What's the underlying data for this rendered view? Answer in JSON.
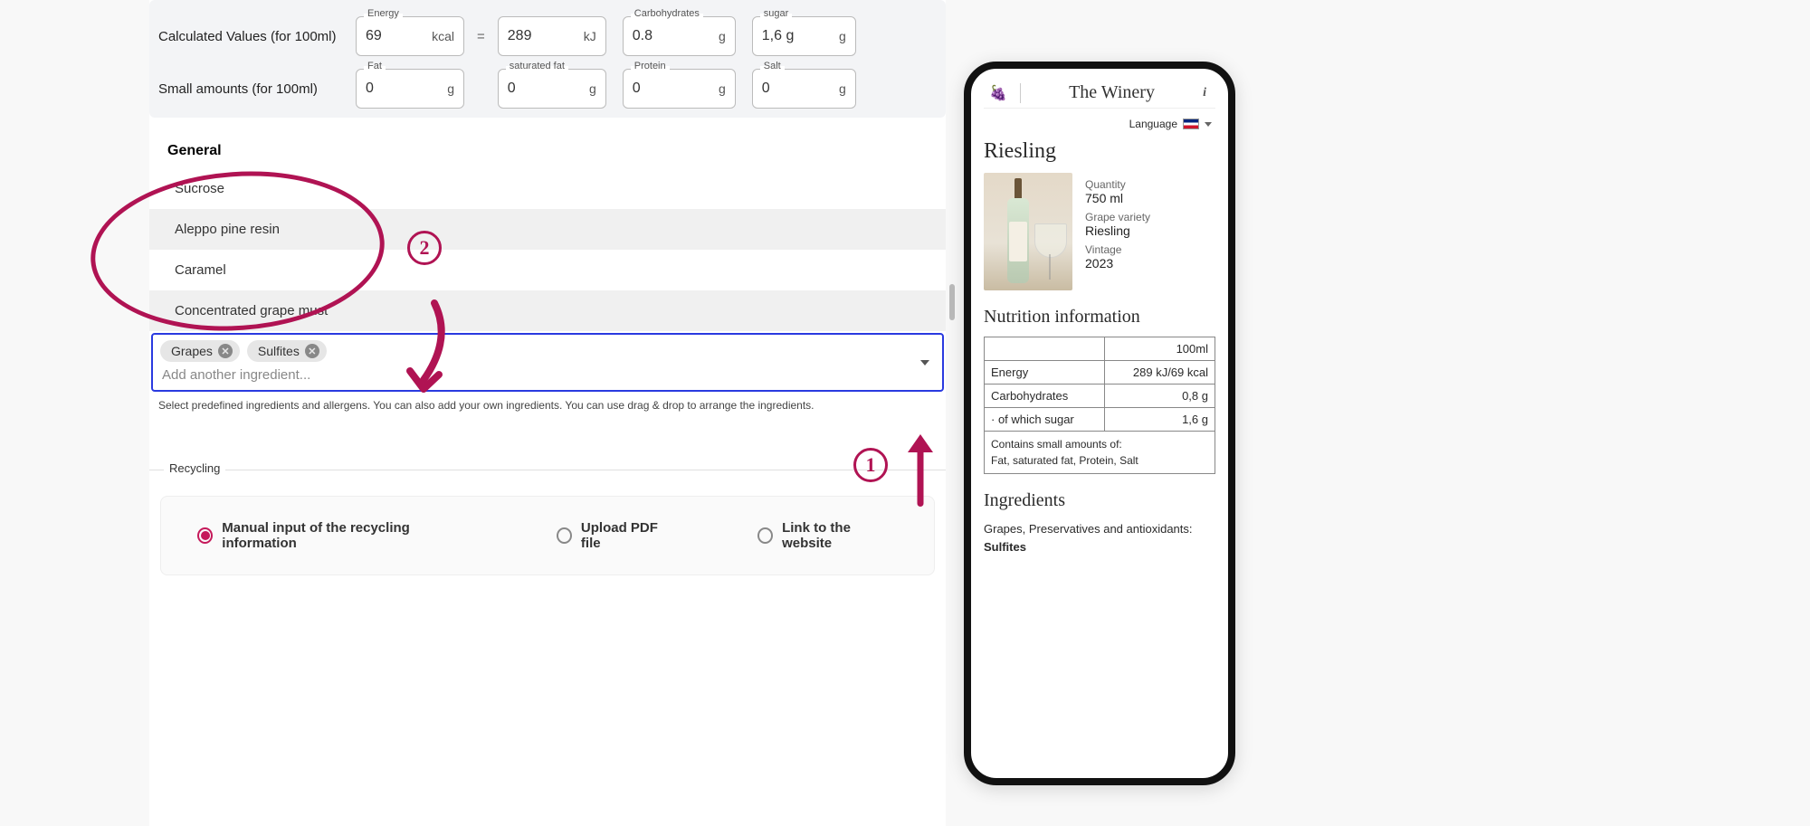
{
  "calc": {
    "label": "Calculated Values (for 100ml)",
    "energy_label": "Energy",
    "energy_kcal": "69",
    "energy_kcal_unit": "kcal",
    "eq": "=",
    "energy_kj": "289",
    "energy_kj_unit": "kJ",
    "carbs_label": "Carbohydrates",
    "carbs": "0.8",
    "carbs_unit": "g",
    "sugar_label": "sugar",
    "sugar": "1,6 g",
    "sugar_unit": "g"
  },
  "small": {
    "label": "Small amounts (for 100ml)",
    "fat_label": "Fat",
    "fat": "0",
    "fat_unit": "g",
    "satfat_label": "saturated fat",
    "satfat": "0",
    "satfat_unit": "g",
    "protein_label": "Protein",
    "protein": "0",
    "protein_unit": "g",
    "salt_label": "Salt",
    "salt": "0",
    "salt_unit": "g"
  },
  "dropdown": {
    "header": "General",
    "items": [
      "Sucrose",
      "Aleppo pine resin",
      "Caramel",
      "Concentrated grape must"
    ]
  },
  "ingredients": {
    "chips": [
      "Grapes",
      "Sulfites"
    ],
    "placeholder": "Add another ingredient...",
    "helper": "Select predefined ingredients and allergens. You can also add your own ingredients. You can use drag & drop to arrange the ingredients."
  },
  "recycling": {
    "legend": "Recycling",
    "opts": [
      "Manual input of the recycling information",
      "Upload PDF file",
      "Link to the website"
    ],
    "selected": 0
  },
  "annotations": {
    "badge1": "1",
    "badge2": "2"
  },
  "phone": {
    "brand": "The Winery",
    "language_label": "Language",
    "title": "Riesling",
    "meta": {
      "quantity_label": "Quantity",
      "quantity": "750 ml",
      "grape_label": "Grape variety",
      "grape": "Riesling",
      "vintage_label": "Vintage",
      "vintage": "2023"
    },
    "nutrition_header": "Nutrition information",
    "col_header": "100ml",
    "rows": {
      "energy_label": "Energy",
      "energy_val": "289 kJ/69 kcal",
      "carbs_label": "Carbohydrates",
      "carbs_val": "0,8 g",
      "sugar_label": "· of which sugar",
      "sugar_val": "1,6 g",
      "small_text": "Contains small amounts of:\nFat, saturated fat, Protein, Salt"
    },
    "ingredients_header": "Ingredients",
    "ingredients_text_a": "Grapes, Preservatives and antioxidants:",
    "ingredients_text_b": "Sulfites"
  }
}
